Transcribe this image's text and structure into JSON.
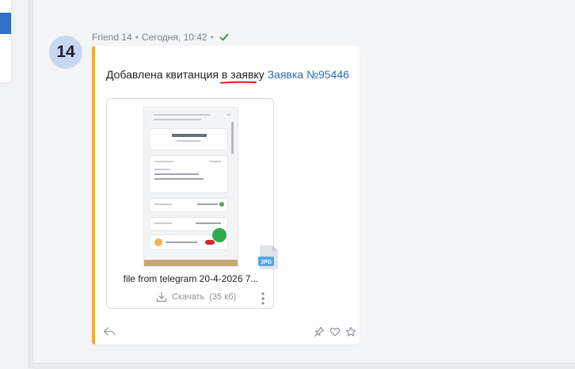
{
  "message": {
    "avatar_label": "14",
    "author": "Friend 14",
    "time": "Сегодня, 10:42",
    "text_prefix": "Добавлена квитанция в заявку ",
    "link_text": "Заявка №95446"
  },
  "attachment": {
    "filename": "file from telegram 20-4-2026 7...",
    "download_label": "Скачать",
    "size": "(35 кб)",
    "file_type": "JPG"
  },
  "colors": {
    "accent_bar": "#f6ae1a",
    "link": "#2d6bb6",
    "avatar_bg": "#c8d6f2",
    "read_check": "#1f9d57",
    "annotation": "#d62020"
  }
}
